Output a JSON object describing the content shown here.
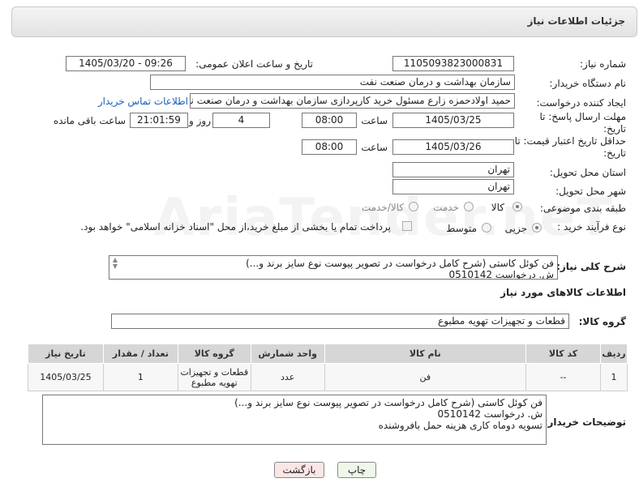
{
  "header": {
    "title": "جزئیات اطلاعات نیاز"
  },
  "labels": {
    "need_number": "شماره نیاز:",
    "announce_datetime": "تاریخ و ساعت اعلان عمومی:",
    "buyer_org": "نام دستگاه خریدار:",
    "requester": "ایجاد کننده درخواست:",
    "response_deadline": "مهلت ارسال پاسخ: تا تاریخ:",
    "price_validity": "حداقل تاریخ اعتبار قیمت: تا تاریخ:",
    "time_word": "ساعت",
    "days_word": "روز و",
    "remaining_word": "ساعت باقی مانده",
    "province": "استان محل تحویل:",
    "city": "شهر محل تحویل:",
    "category": "طبقه بندی موضوعی:",
    "process_type": "نوع فرآیند خرید :",
    "general_desc": "شرح کلی نیاز:",
    "goods_info": "اطلاعات کالاهای مورد نیاز",
    "goods_group": "گروه کالا:",
    "buyer_notes": "توضیحات خریدار:"
  },
  "fields": {
    "need_number": "1105093823000831",
    "announce_datetime": "1405/03/20 - 09:26",
    "buyer_org": "سازمان بهداشت و درمان صنعت نفت",
    "requester": "حمید اولادحمزه زارع مسئول خرید کارپردازی سازمان بهداشت و درمان صنعت نفت",
    "contact_link": "اطلاعات تماس خریدار",
    "response_date": "1405/03/25",
    "response_time": "08:00",
    "days_left": "4",
    "time_left": "21:01:59",
    "price_date": "1405/03/26",
    "price_time": "08:00",
    "province": "تهران",
    "city": "تهران",
    "goods_group": "قطعات و تجهیزات تهویه مطبوع"
  },
  "category_options": [
    {
      "label": "کالا",
      "checked": true
    },
    {
      "label": "خدمت",
      "checked": false
    },
    {
      "label": "کالا/خدمت",
      "checked": false
    }
  ],
  "process_options": [
    {
      "label": "جزیی",
      "checked": true
    },
    {
      "label": "متوسط",
      "checked": false
    }
  ],
  "payment_note": "پرداخت تمام یا بخشی از مبلغ خرید،از محل \"اسناد خزانه اسلامی\" خواهد بود.",
  "general_desc": "فن کوئل کاستی (شرح کامل درخواست در تصویر پیوست  نوع سایز برند و...)\nش. درخواست 0510142",
  "table": {
    "headers": [
      "ردیف",
      "کد کالا",
      "نام کالا",
      "واحد شمارش",
      "گروه کالا",
      "تعداد / مقدار",
      "تاریخ نیاز"
    ],
    "rows": [
      [
        "1",
        "--",
        "فن",
        "عدد",
        "قطعات و تجهیزات تهویه مطبوع",
        "1",
        "1405/03/25"
      ]
    ]
  },
  "buyer_notes": "فن کوئل کاستی (شرح کامل درخواست در تصویر پیوست  نوع سایز برند و...)\nش. درخواست 0510142\nتسویه دوماه کاری هزینه حمل بافروشنده",
  "buttons": {
    "print": "چاپ",
    "back": "بازگشت"
  },
  "watermark": "AriaTender.neT"
}
